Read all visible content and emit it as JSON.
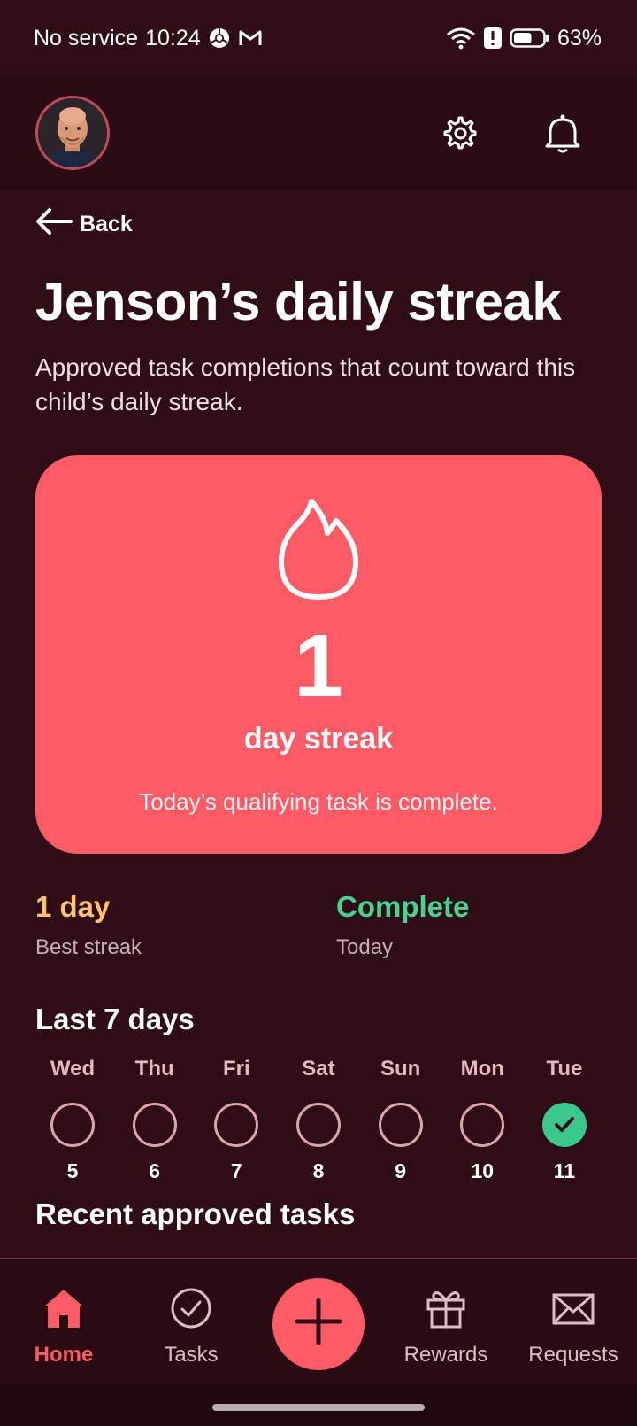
{
  "status_bar": {
    "carrier": "No service",
    "time": "10:24",
    "battery_percent": "63%",
    "battery_level": 0.63,
    "icons": [
      "chrome-icon",
      "gmail-icon",
      "wifi-icon",
      "alert-icon",
      "battery-icon"
    ]
  },
  "header": {
    "avatar_icon": "avatar",
    "settings_icon": "gear-icon",
    "notifications_icon": "bell-icon"
  },
  "back": {
    "label": "Back"
  },
  "page": {
    "title": "Jenson’s daily streak",
    "subtitle": "Approved task completions that count toward this child’s daily streak."
  },
  "streak_card": {
    "count": "1",
    "unit": "day streak",
    "note": "Today’s qualifying task is complete.",
    "background": "#ff5b67"
  },
  "stats": {
    "best": {
      "value": "1 day",
      "label": "Best streak",
      "color": "#ffc36b"
    },
    "today": {
      "value": "Complete",
      "label": "Today",
      "color": "#45d391"
    }
  },
  "last7": {
    "heading": "Last 7 days",
    "days": [
      {
        "name": "Wed",
        "num": "5",
        "done": false
      },
      {
        "name": "Thu",
        "num": "6",
        "done": false
      },
      {
        "name": "Fri",
        "num": "7",
        "done": false
      },
      {
        "name": "Sat",
        "num": "8",
        "done": false
      },
      {
        "name": "Sun",
        "num": "9",
        "done": false
      },
      {
        "name": "Mon",
        "num": "10",
        "done": false
      },
      {
        "name": "Tue",
        "num": "11",
        "done": true
      }
    ]
  },
  "recent": {
    "heading": "Recent approved tasks"
  },
  "nav": {
    "home": "Home",
    "tasks": "Tasks",
    "rewards": "Rewards",
    "requests": "Requests",
    "accent": "#ff5b67"
  }
}
